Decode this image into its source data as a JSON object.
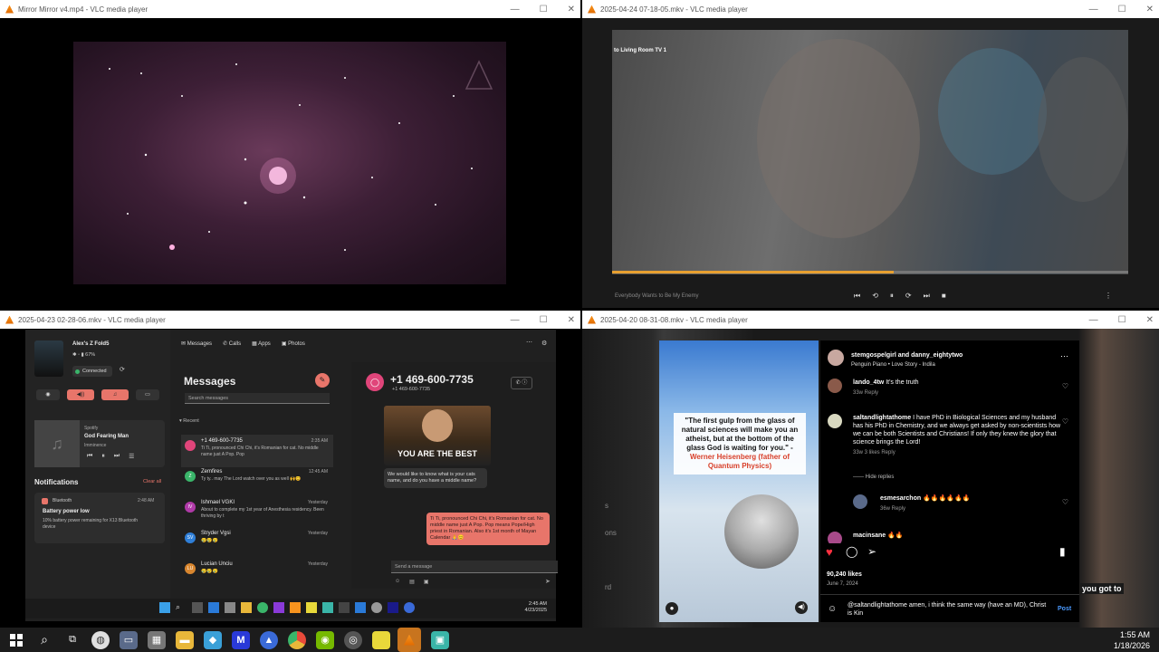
{
  "windows": {
    "top_left": {
      "title": "Mirror Mirror v4.mp4 - VLC media player"
    },
    "top_right": {
      "title": "2025-04-24 07-18-05.mkv - VLC media player",
      "cast_label": "to Living Room TV 1",
      "song": "Everybody Wants to Be My Enemy",
      "progress": 0.545
    },
    "bottom_left": {
      "title": "2025-04-23 02-28-06.mkv - VLC media player"
    },
    "bottom_right": {
      "title": "2025-04-20 08-31-08.mkv - VLC media player"
    }
  },
  "phone_link": {
    "device_name": "Alex's Z Fold5",
    "battery": "67%",
    "connected": "Connected",
    "tabs": [
      "Messages",
      "Calls",
      "Apps",
      "Photos"
    ],
    "media": {
      "app": "Spotify",
      "track": "God Fearing Man",
      "artist": "Imminence"
    },
    "notifications_title": "Notifications",
    "clear_all": "Clear all",
    "notification": {
      "app": "Bluetooth",
      "time": "2:48 AM",
      "title": "Battery power low",
      "body": "10% battery power remaining for X13 Bluetooth device"
    },
    "messages_title": "Messages",
    "search_placeholder": "Search messages",
    "recent_label": "Recent",
    "conversations": [
      {
        "initials": "",
        "name": "+1 469-600-7735",
        "time": "2:35 AM",
        "preview": "Ti Ti, pronounced Chi Chi, it's Romanian for cat. No middle name just A Pop. Pop",
        "color": "#e0457a"
      },
      {
        "initials": "Z",
        "name": "Zemfires",
        "time": "12:45 AM",
        "preview": "Ty ty.. may The Lord watch over you as well 🙌😊",
        "color": "#3ab56a"
      },
      {
        "initials": "IV",
        "name": "Ishmael VGKI",
        "time": "Yesterday",
        "preview": "About to complete my 1st year of Anesthesia residency. Been thriving by t",
        "color": "#b03aa8"
      },
      {
        "initials": "SV",
        "name": "Stryder Vgsi",
        "time": "Yesterday",
        "preview": "😢😢😢",
        "color": "#2f7fd8"
      },
      {
        "initials": "LU",
        "name": "Lucian Unciu",
        "time": "Yesterday",
        "preview": "😢😢😢",
        "color": "#d8862f"
      }
    ],
    "chat": {
      "number": "+1 469-600-7735",
      "sub": "+1 469-600-7735",
      "meme_text": "YOU ARE THE BEST",
      "incoming": "We would like to know what is your cats name, and do you have a middle name?",
      "outgoing": "Ti Ti, pronounced Chi Chi, it's Romanian for cat. No middle name just A Pop. Pop means Pope/High priest in Romanian. Also it's 1st month of Mayan Calendar 🙏😊",
      "send_placeholder": "Send a message"
    },
    "inner_taskbar": {
      "time": "2:45 AM",
      "date": "4/23/2025"
    }
  },
  "instagram": {
    "quote": "\"The first gulp from the glass of natural sciences will make you an atheist, but at the bottom of the glass God is waiting for you.\" -",
    "quote_author": "Werner Heisenberg (father of Quantum Physics)",
    "header_users": "stemgospelgirl and danny_eightytwo",
    "header_song": "Penguin Piano • Love Story - Indila",
    "comments": [
      {
        "user": "lando_4tw",
        "text": "It's the truth",
        "meta": "33w   Reply"
      },
      {
        "user": "saltandlightathome",
        "text": "I have PhD in Biological Sciences and my husband has his PhD in Chemistry, and we always get asked by non-scientists how we can be both Scientists and Christians! If only they knew the glory that science brings the Lord!",
        "meta": "33w   3 likes   Reply"
      },
      {
        "user": "esmesarchon",
        "text": "🔥🔥🔥🔥🔥🔥",
        "meta": "36w   Reply"
      },
      {
        "user": "macinsane",
        "text": "🔥🔥",
        "meta": ""
      }
    ],
    "hide_replies": "Hide replies",
    "likes": "90,240 likes",
    "date": "June 7, 2024",
    "comment_draft": "@saltandlightathome amen, i think the same way (have an MD), Christ is Kin",
    "post_button": "Post"
  },
  "side_labels": [
    "s",
    "ons",
    "rd",
    "you got to"
  ],
  "taskbar": {
    "time": "1:55 AM",
    "date": "1/18/2026"
  }
}
